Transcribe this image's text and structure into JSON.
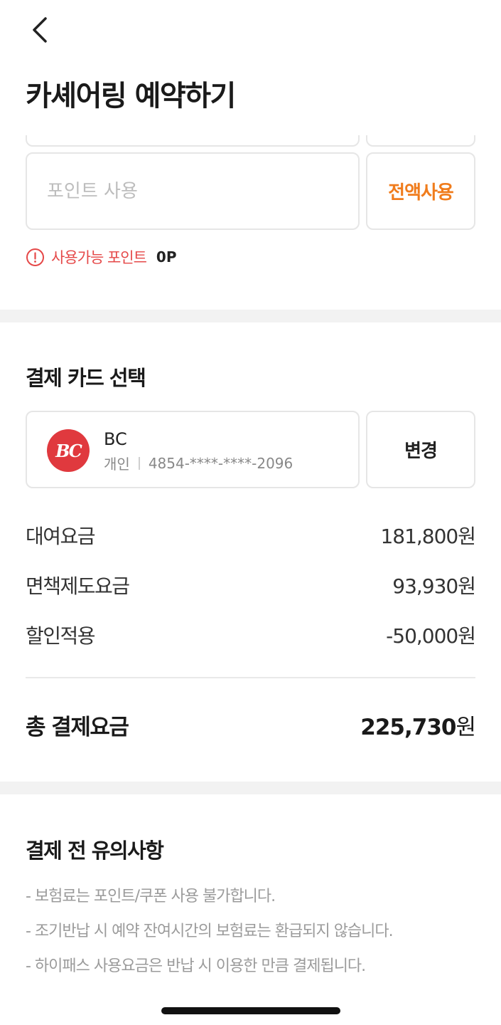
{
  "header": {
    "title": "카셰어링 예약하기",
    "back_icon": "chevron-left-icon"
  },
  "points": {
    "placeholder": "포인트 사용",
    "use_all_label": "전액사용",
    "available_label": "사용가능 포인트",
    "available_value": "0P",
    "warning_color": "#e54848",
    "accent_color": "#f07c1c"
  },
  "card_section": {
    "title": "결제 카드 선택",
    "card": {
      "logo_text": "BC",
      "name": "BC",
      "type": "개인",
      "number": "4854-****-****-2096",
      "brand_color": "#e0393e"
    },
    "change_label": "변경"
  },
  "fees": [
    {
      "label": "대여요금",
      "value": "181,800원"
    },
    {
      "label": "면책제도요금",
      "value": "93,930원"
    },
    {
      "label": "할인적용",
      "value": "-50,000원"
    }
  ],
  "total": {
    "label": "총 결제요금",
    "amount": "225,730",
    "unit": "원"
  },
  "notice": {
    "title": "결제 전 유의사항",
    "items": [
      "- 보험료는 포인트/쿠폰 사용 불가합니다.",
      "- 조기반납 시 예약 잔여시간의 보험료는 환급되지 않습니다.",
      "- 하이패스 사용요금은 반납 시 이용한 만큼 결제됩니다."
    ]
  }
}
